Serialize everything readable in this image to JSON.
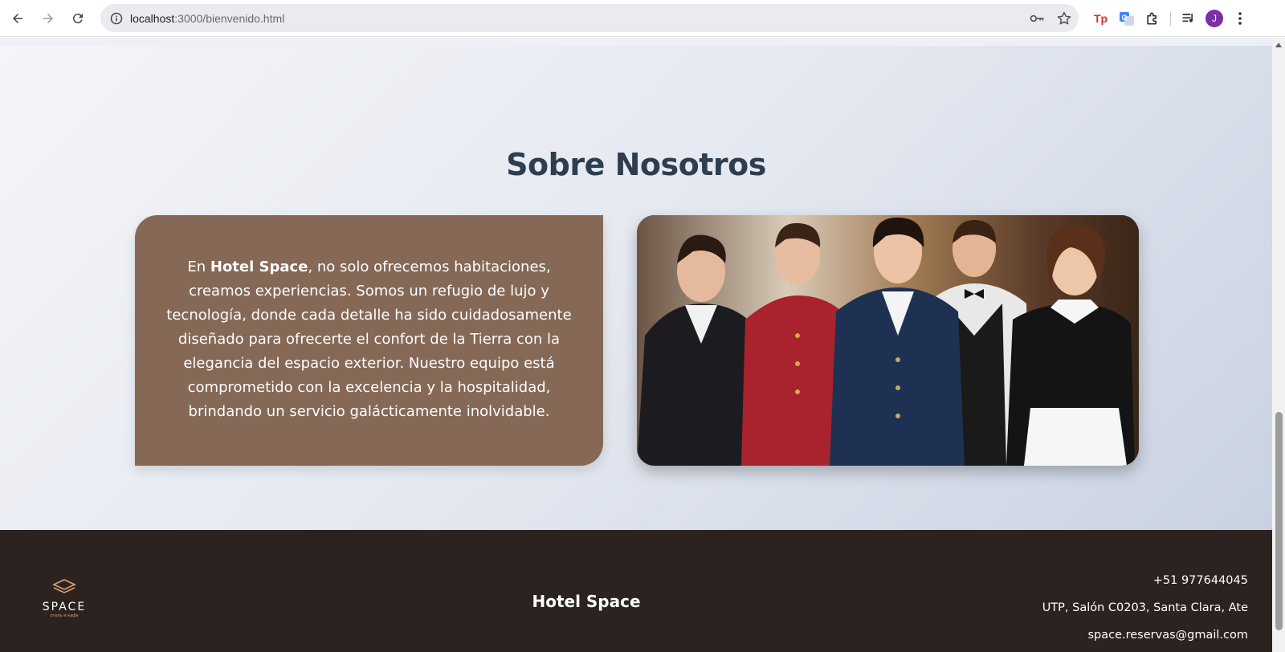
{
  "browser": {
    "url_host": "localhost",
    "url_path": ":3000/bienvenido.html",
    "avatar_letter": "J"
  },
  "about": {
    "title": "Sobre Nosotros",
    "text_before": "En ",
    "brand": "Hotel Space",
    "text_after": ", no solo ofrecemos habitaciones, creamos experiencias. Somos un refugio de lujo y tecnología, donde cada detalle ha sido cuidadosamente diseñado para ofrecerte el confort de la Tierra con la elegancia del espacio exterior. Nuestro equipo está comprometido con la excelencia y la hospitalidad, brindando un servicio galácticamente inolvidable."
  },
  "footer": {
    "logo_word": "SPACE",
    "logo_tagline": "отель и кафе",
    "brand": "Hotel Space",
    "phone": "+51 977644045",
    "address": "UTP, Salón C0203, Santa Clara, Ate",
    "email": "space.reservas@gmail.com"
  },
  "colors": {
    "title": "#2c3e50",
    "card": "#856856",
    "footer": "#2c221f",
    "avatar": "#7b2fa6"
  },
  "icons": [
    "back-icon",
    "forward-icon",
    "reload-icon",
    "site-info-icon",
    "key-icon",
    "star-icon",
    "tp-extension-icon",
    "translate-extension-icon",
    "extensions-puzzle-icon",
    "media-control-icon",
    "menu-kebab-icon"
  ]
}
